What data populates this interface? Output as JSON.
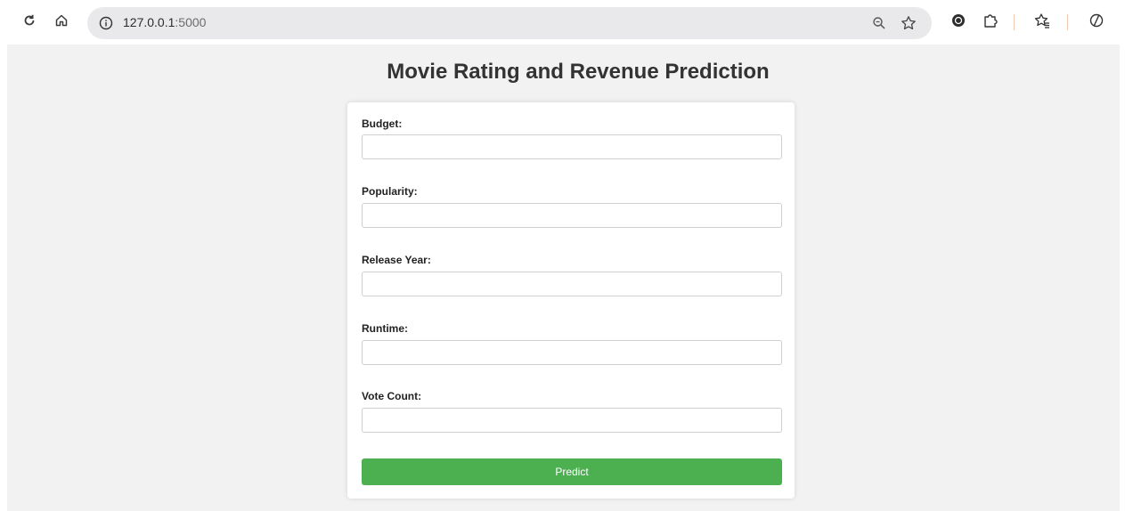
{
  "browser": {
    "url_host": "127.0.0.1",
    "url_port": ":5000",
    "icons": {
      "reload": "reload-icon",
      "home": "home-icon",
      "site_info": "info-icon",
      "zoom": "zoom-icon",
      "bookmark": "star-icon",
      "extension_a": "extension-icon",
      "extensions": "puzzle-icon",
      "favorites": "favorites-icon",
      "copilot": "copilot-icon"
    }
  },
  "page": {
    "title": "Movie Rating and Revenue Prediction",
    "fields": [
      {
        "label": "Budget:",
        "value": ""
      },
      {
        "label": "Popularity:",
        "value": ""
      },
      {
        "label": "Release Year:",
        "value": ""
      },
      {
        "label": "Runtime:",
        "value": ""
      },
      {
        "label": "Vote Count:",
        "value": ""
      }
    ],
    "submit_label": "Predict"
  },
  "colors": {
    "accent": "#4caf50",
    "page_background": "#f2f2f2",
    "title_text": "#333333"
  }
}
